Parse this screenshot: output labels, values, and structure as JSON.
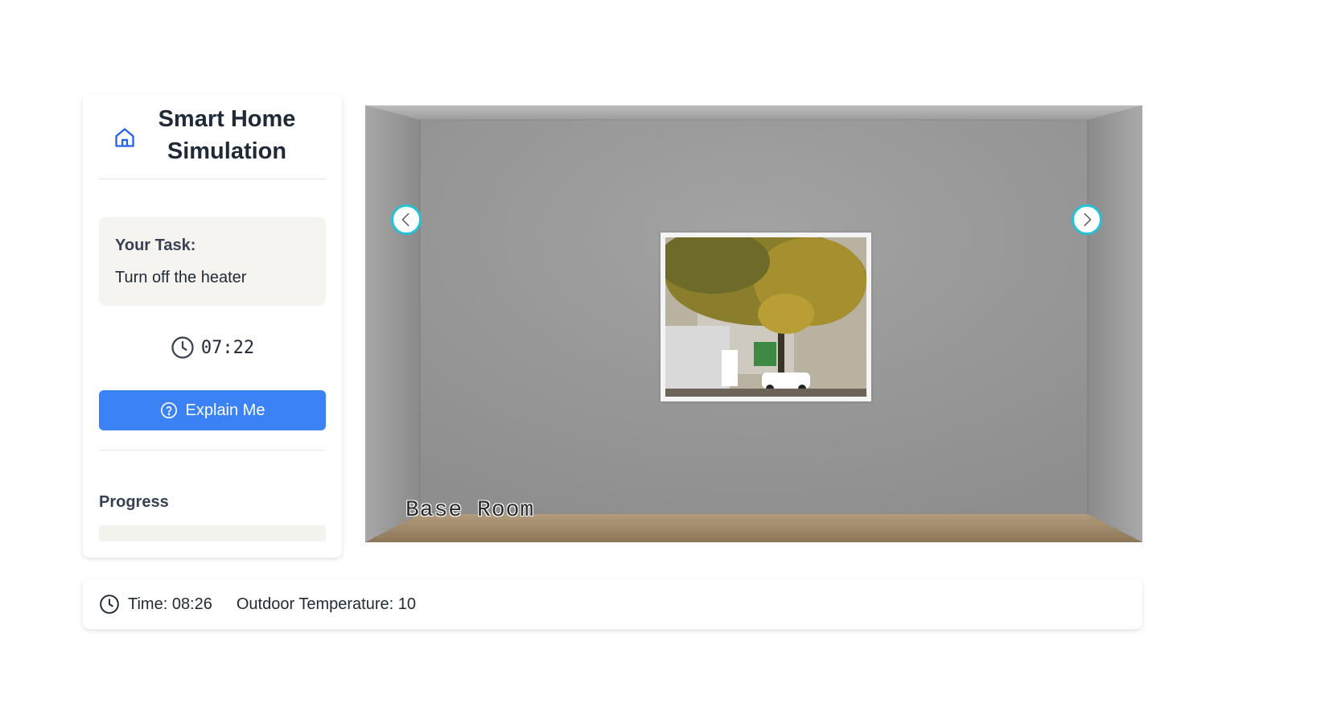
{
  "sidebar": {
    "title": "Smart Home Simulation",
    "task_label": "Your Task:",
    "task_text": "Turn off the heater",
    "timer": "07:22",
    "explain_button": "Explain Me",
    "progress_label": "Progress",
    "progress_fraction": 0
  },
  "room": {
    "name": "Base Room",
    "left_arrow_icon": "chevron-left-icon",
    "right_arrow_icon": "chevron-right-icon"
  },
  "status": {
    "time": "Time: 08:26",
    "outdoor_temperature": "Outdoor Temperature: 10"
  },
  "colors": {
    "accent": "#3b82f6",
    "arrow_ring": "#22c3d6",
    "task_bg": "#f5f4f0"
  }
}
